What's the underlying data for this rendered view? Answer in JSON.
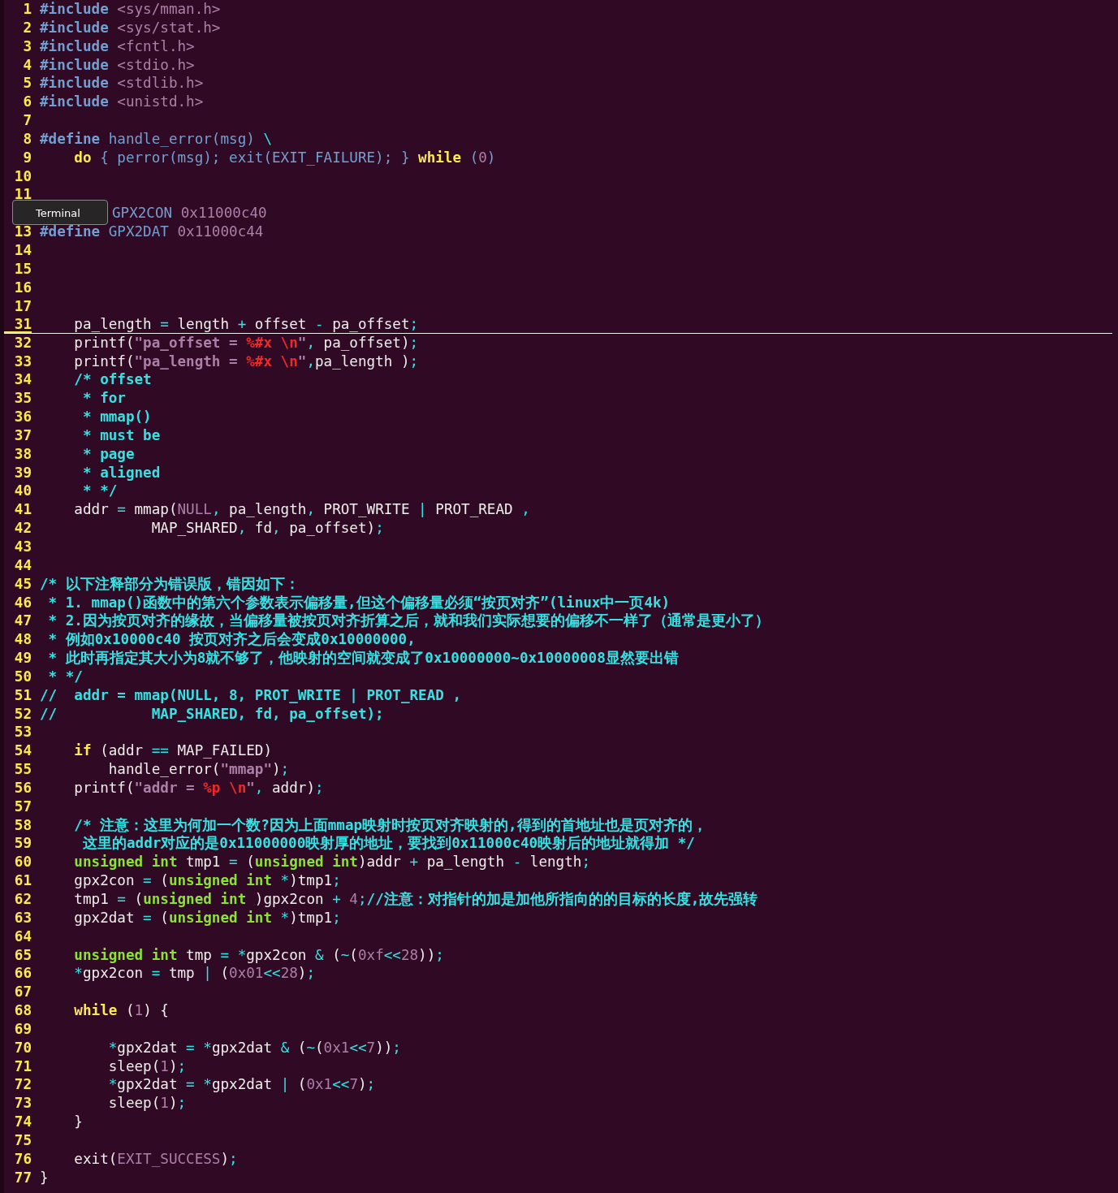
{
  "tooltip": {
    "label": "Terminal"
  },
  "lines": [
    {
      "n": "1",
      "cursor": false,
      "code": [
        {
          "t": "#include",
          "kind": "pp"
        },
        {
          "t": " <sys/mman.h>",
          "kind": "hdr"
        }
      ]
    },
    {
      "n": "2",
      "cursor": false,
      "code": [
        {
          "t": "#include",
          "kind": "pp"
        },
        {
          "t": " <sys/stat.h>",
          "kind": "hdr"
        }
      ]
    },
    {
      "n": "3",
      "cursor": false,
      "code": [
        {
          "t": "#include",
          "kind": "pp"
        },
        {
          "t": " <fcntl.h>",
          "kind": "hdr"
        }
      ]
    },
    {
      "n": "4",
      "cursor": false,
      "code": [
        {
          "t": "#include",
          "kind": "pp"
        },
        {
          "t": " <stdio.h>",
          "kind": "hdr"
        }
      ]
    },
    {
      "n": "5",
      "cursor": false,
      "code": [
        {
          "t": "#include",
          "kind": "pp"
        },
        {
          "t": " <stdlib.h>",
          "kind": "hdr"
        }
      ]
    },
    {
      "n": "6",
      "cursor": false,
      "code": [
        {
          "t": "#include",
          "kind": "pp"
        },
        {
          "t": " <unistd.h>",
          "kind": "hdr"
        }
      ]
    },
    {
      "n": "7",
      "cursor": false
    },
    {
      "n": "8",
      "cursor": false,
      "code": [
        {
          "t": "#define",
          "kind": "pp"
        },
        {
          "t": " handle_error(msg) ",
          "kind": "pp2"
        },
        {
          "t": "\\",
          "kind": "op"
        }
      ]
    },
    {
      "n": "9",
      "cursor": false,
      "code": [
        {
          "t": "    do",
          "kind": "kw"
        },
        {
          "t": " { perror(msg); exit(EXIT_FAILURE); } ",
          "kind": "pp2"
        },
        {
          "t": "while",
          "kind": "kw"
        },
        {
          "t": " (",
          "kind": "pp2"
        },
        {
          "t": "0",
          "kind": "num"
        },
        {
          "t": ")",
          "kind": "pp2"
        }
      ]
    },
    {
      "n": "10",
      "cursor": false
    },
    {
      "n": "11",
      "cursor": false
    },
    {
      "cursor": false,
      "kind": "covered",
      "code": [
        {
          "t": "GPX2CON ",
          "kind": "pp2"
        },
        {
          "t": "0x11000c40",
          "kind": "num"
        }
      ]
    },
    {
      "n": "13",
      "cursor": false,
      "code": [
        {
          "t": "#define",
          "kind": "pp"
        },
        {
          "t": " GPX2DAT ",
          "kind": "pp2"
        },
        {
          "t": "0x11000c44",
          "kind": "num"
        }
      ]
    },
    {
      "n": "14",
      "cursor": false
    },
    {
      "n": "15",
      "cursor": false
    },
    {
      "n": "16",
      "cursor": false
    },
    {
      "n": "17",
      "cursor": false
    },
    {
      "n": "31",
      "cursor": true,
      "code": [
        {
          "t": "    pa_length ",
          "kind": "plain"
        },
        {
          "t": "=",
          "kind": "op"
        },
        {
          "t": " length ",
          "kind": "plain"
        },
        {
          "t": "+",
          "kind": "op"
        },
        {
          "t": " offset ",
          "kind": "plain"
        },
        {
          "t": "-",
          "kind": "op"
        },
        {
          "t": " pa_offset",
          "kind": "plain"
        },
        {
          "t": ";",
          "kind": "op"
        }
      ]
    },
    {
      "n": "32",
      "cursor": false,
      "code": [
        {
          "t": "    printf(",
          "kind": "plain"
        },
        {
          "t": "\"pa_offset = ",
          "kind": "str"
        },
        {
          "t": "%#x \\n",
          "kind": "esc"
        },
        {
          "t": "\"",
          "kind": "str"
        },
        {
          "t": ",",
          "kind": "op"
        },
        {
          "t": " pa_offset)",
          "kind": "plain"
        },
        {
          "t": ";",
          "kind": "op"
        }
      ]
    },
    {
      "n": "33",
      "cursor": false,
      "code": [
        {
          "t": "    printf(",
          "kind": "plain"
        },
        {
          "t": "\"pa_length = ",
          "kind": "str"
        },
        {
          "t": "%#x \\n",
          "kind": "esc"
        },
        {
          "t": "\"",
          "kind": "str"
        },
        {
          "t": ",",
          "kind": "op"
        },
        {
          "t": "pa_length )",
          "kind": "plain"
        },
        {
          "t": ";",
          "kind": "op"
        }
      ]
    },
    {
      "n": "34",
      "cursor": false,
      "code": [
        {
          "t": "    /* offset",
          "kind": "cm"
        }
      ]
    },
    {
      "n": "35",
      "cursor": false,
      "code": [
        {
          "t": "     * for",
          "kind": "cm"
        }
      ]
    },
    {
      "n": "36",
      "cursor": false,
      "code": [
        {
          "t": "     * mmap()",
          "kind": "cm"
        }
      ]
    },
    {
      "n": "37",
      "cursor": false,
      "code": [
        {
          "t": "     * must be",
          "kind": "cm"
        }
      ]
    },
    {
      "n": "38",
      "cursor": false,
      "code": [
        {
          "t": "     * page",
          "kind": "cm"
        }
      ]
    },
    {
      "n": "39",
      "cursor": false,
      "code": [
        {
          "t": "     * aligned",
          "kind": "cm"
        }
      ]
    },
    {
      "n": "40",
      "cursor": false,
      "code": [
        {
          "t": "     * */",
          "kind": "cm"
        }
      ]
    },
    {
      "n": "41",
      "cursor": false,
      "code": [
        {
          "t": "    addr ",
          "kind": "plain"
        },
        {
          "t": "=",
          "kind": "op"
        },
        {
          "t": " mmap(",
          "kind": "plain"
        },
        {
          "t": "NULL",
          "kind": "num"
        },
        {
          "t": ",",
          "kind": "op"
        },
        {
          "t": " pa_length",
          "kind": "plain"
        },
        {
          "t": ",",
          "kind": "op"
        },
        {
          "t": " PROT_WRITE ",
          "kind": "plain"
        },
        {
          "t": "|",
          "kind": "op"
        },
        {
          "t": " PROT_READ ",
          "kind": "plain"
        },
        {
          "t": ",",
          "kind": "op"
        }
      ]
    },
    {
      "n": "42",
      "cursor": false,
      "code": [
        {
          "t": "             MAP_SHARED",
          "kind": "plain"
        },
        {
          "t": ",",
          "kind": "op"
        },
        {
          "t": " fd",
          "kind": "plain"
        },
        {
          "t": ",",
          "kind": "op"
        },
        {
          "t": " pa_offset)",
          "kind": "plain"
        },
        {
          "t": ";",
          "kind": "op"
        }
      ]
    },
    {
      "n": "43",
      "cursor": false
    },
    {
      "n": "44",
      "cursor": false
    },
    {
      "n": "45",
      "cursor": false,
      "code": [
        {
          "t": "/* 以下注释部分为错误版，错因如下：",
          "kind": "cm"
        }
      ]
    },
    {
      "n": "46",
      "cursor": false,
      "code": [
        {
          "t": " * 1. mmap()函数中的第六个参数表示偏移量,但这个偏移量必须“按页对齐”(linux中一页4k)",
          "kind": "cm"
        }
      ]
    },
    {
      "n": "47",
      "cursor": false,
      "code": [
        {
          "t": " * 2.因为按页对齐的缘故，当偏移量被按页对齐折算之后，就和我们实际想要的偏移不一样了（通常是更小了）",
          "kind": "cm"
        }
      ]
    },
    {
      "n": "48",
      "cursor": false,
      "code": [
        {
          "t": " * 例如0x10000c40 按页对齐之后会变成0x10000000,",
          "kind": "cm"
        }
      ]
    },
    {
      "n": "49",
      "cursor": false,
      "code": [
        {
          "t": " * 此时再指定其大小为8就不够了，他映射的空间就变成了0x10000000~0x10000008显然要出错",
          "kind": "cm"
        }
      ]
    },
    {
      "n": "50",
      "cursor": false,
      "code": [
        {
          "t": " * */",
          "kind": "cm"
        }
      ]
    },
    {
      "n": "51",
      "cursor": false,
      "code": [
        {
          "t": "//  addr = mmap(NULL, 8, PROT_WRITE | PROT_READ ,",
          "kind": "cm"
        }
      ]
    },
    {
      "n": "52",
      "cursor": false,
      "code": [
        {
          "t": "//           MAP_SHARED, fd, pa_offset);",
          "kind": "cm"
        }
      ]
    },
    {
      "n": "53",
      "cursor": false
    },
    {
      "n": "54",
      "cursor": false,
      "code": [
        {
          "t": "    if",
          "kind": "kw"
        },
        {
          "t": " (addr ",
          "kind": "plain"
        },
        {
          "t": "==",
          "kind": "op"
        },
        {
          "t": " MAP_FAILED)",
          "kind": "plain"
        }
      ]
    },
    {
      "n": "55",
      "cursor": false,
      "code": [
        {
          "t": "        handle_error(",
          "kind": "plain"
        },
        {
          "t": "\"mmap\"",
          "kind": "str"
        },
        {
          "t": ")",
          "kind": "plain"
        },
        {
          "t": ";",
          "kind": "op"
        }
      ]
    },
    {
      "n": "56",
      "cursor": false,
      "code": [
        {
          "t": "    printf(",
          "kind": "plain"
        },
        {
          "t": "\"addr = ",
          "kind": "str"
        },
        {
          "t": "%p \\n",
          "kind": "esc"
        },
        {
          "t": "\"",
          "kind": "str"
        },
        {
          "t": ",",
          "kind": "op"
        },
        {
          "t": " addr)",
          "kind": "plain"
        },
        {
          "t": ";",
          "kind": "op"
        }
      ]
    },
    {
      "n": "57",
      "cursor": false
    },
    {
      "n": "58",
      "cursor": false,
      "code": [
        {
          "t": "    /* 注意：这里为何加一个数?因为上面mmap映射时按页对齐映射的,得到的首地址也是页对齐的，",
          "kind": "cm"
        }
      ]
    },
    {
      "n": "59",
      "cursor": false,
      "code": [
        {
          "t": "     这里的addr对应的是0x11000000映射厚的地址，要找到0x11000c40映射后的地址就得加 */",
          "kind": "cm"
        }
      ]
    },
    {
      "n": "60",
      "cursor": false,
      "code": [
        {
          "t": "    unsigned int",
          "kind": "type"
        },
        {
          "t": " tmp1 ",
          "kind": "plain"
        },
        {
          "t": "=",
          "kind": "op"
        },
        {
          "t": " (",
          "kind": "plain"
        },
        {
          "t": "unsigned int",
          "kind": "type"
        },
        {
          "t": ")addr ",
          "kind": "plain"
        },
        {
          "t": "+",
          "kind": "op"
        },
        {
          "t": " pa_length ",
          "kind": "plain"
        },
        {
          "t": "-",
          "kind": "op"
        },
        {
          "t": " length",
          "kind": "plain"
        },
        {
          "t": ";",
          "kind": "op"
        }
      ]
    },
    {
      "n": "61",
      "cursor": false,
      "code": [
        {
          "t": "    gpx2con ",
          "kind": "plain"
        },
        {
          "t": "=",
          "kind": "op"
        },
        {
          "t": " (",
          "kind": "plain"
        },
        {
          "t": "unsigned int",
          "kind": "type"
        },
        {
          "t": " *",
          "kind": "op"
        },
        {
          "t": ")tmp1",
          "kind": "plain"
        },
        {
          "t": ";",
          "kind": "op"
        }
      ]
    },
    {
      "n": "62",
      "cursor": false,
      "code": [
        {
          "t": "    tmp1 ",
          "kind": "plain"
        },
        {
          "t": "=",
          "kind": "op"
        },
        {
          "t": " (",
          "kind": "plain"
        },
        {
          "t": "unsigned int",
          "kind": "type"
        },
        {
          "t": " )gpx2con ",
          "kind": "plain"
        },
        {
          "t": "+",
          "kind": "op"
        },
        {
          "t": " 4",
          "kind": "num"
        },
        {
          "t": ";",
          "kind": "op"
        },
        {
          "t": "//注意：对指针的加是加他所指向的的目标的长度,故先强转",
          "kind": "cm"
        }
      ]
    },
    {
      "n": "63",
      "cursor": false,
      "code": [
        {
          "t": "    gpx2dat ",
          "kind": "plain"
        },
        {
          "t": "=",
          "kind": "op"
        },
        {
          "t": " (",
          "kind": "plain"
        },
        {
          "t": "unsigned int",
          "kind": "type"
        },
        {
          "t": " *",
          "kind": "op"
        },
        {
          "t": ")tmp1",
          "kind": "plain"
        },
        {
          "t": ";",
          "kind": "op"
        }
      ]
    },
    {
      "n": "64",
      "cursor": false
    },
    {
      "n": "65",
      "cursor": false,
      "code": [
        {
          "t": "    unsigned int",
          "kind": "type"
        },
        {
          "t": " tmp ",
          "kind": "plain"
        },
        {
          "t": "=",
          "kind": "op"
        },
        {
          "t": " *",
          "kind": "op"
        },
        {
          "t": "gpx2con ",
          "kind": "plain"
        },
        {
          "t": "&",
          "kind": "op"
        },
        {
          "t": " (",
          "kind": "plain"
        },
        {
          "t": "~",
          "kind": "op"
        },
        {
          "t": "(",
          "kind": "plain"
        },
        {
          "t": "0xf",
          "kind": "num"
        },
        {
          "t": "<<",
          "kind": "op"
        },
        {
          "t": "28",
          "kind": "num"
        },
        {
          "t": "))",
          "kind": "plain"
        },
        {
          "t": ";",
          "kind": "op"
        }
      ]
    },
    {
      "n": "66",
      "cursor": false,
      "code": [
        {
          "t": "    *",
          "kind": "op"
        },
        {
          "t": "gpx2con ",
          "kind": "plain"
        },
        {
          "t": "=",
          "kind": "op"
        },
        {
          "t": " tmp ",
          "kind": "plain"
        },
        {
          "t": "|",
          "kind": "op"
        },
        {
          "t": " (",
          "kind": "plain"
        },
        {
          "t": "0x01",
          "kind": "num"
        },
        {
          "t": "<<",
          "kind": "op"
        },
        {
          "t": "28",
          "kind": "num"
        },
        {
          "t": ")",
          "kind": "plain"
        },
        {
          "t": ";",
          "kind": "op"
        }
      ]
    },
    {
      "n": "67",
      "cursor": false
    },
    {
      "n": "68",
      "cursor": false,
      "code": [
        {
          "t": "    while",
          "kind": "kw"
        },
        {
          "t": " (",
          "kind": "plain"
        },
        {
          "t": "1",
          "kind": "num"
        },
        {
          "t": ") {",
          "kind": "plain"
        }
      ]
    },
    {
      "n": "69",
      "cursor": false
    },
    {
      "n": "70",
      "cursor": false,
      "code": [
        {
          "t": "        *",
          "kind": "op"
        },
        {
          "t": "gpx2dat ",
          "kind": "plain"
        },
        {
          "t": "=",
          "kind": "op"
        },
        {
          "t": " *",
          "kind": "op"
        },
        {
          "t": "gpx2dat ",
          "kind": "plain"
        },
        {
          "t": "&",
          "kind": "op"
        },
        {
          "t": " (",
          "kind": "plain"
        },
        {
          "t": "~",
          "kind": "op"
        },
        {
          "t": "(",
          "kind": "plain"
        },
        {
          "t": "0x1",
          "kind": "num"
        },
        {
          "t": "<<",
          "kind": "op"
        },
        {
          "t": "7",
          "kind": "num"
        },
        {
          "t": "))",
          "kind": "plain"
        },
        {
          "t": ";",
          "kind": "op"
        }
      ]
    },
    {
      "n": "71",
      "cursor": false,
      "code": [
        {
          "t": "        sleep(",
          "kind": "plain"
        },
        {
          "t": "1",
          "kind": "num"
        },
        {
          "t": ")",
          "kind": "plain"
        },
        {
          "t": ";",
          "kind": "op"
        }
      ]
    },
    {
      "n": "72",
      "cursor": false,
      "code": [
        {
          "t": "        *",
          "kind": "op"
        },
        {
          "t": "gpx2dat ",
          "kind": "plain"
        },
        {
          "t": "=",
          "kind": "op"
        },
        {
          "t": " *",
          "kind": "op"
        },
        {
          "t": "gpx2dat ",
          "kind": "plain"
        },
        {
          "t": "|",
          "kind": "op"
        },
        {
          "t": " (",
          "kind": "plain"
        },
        {
          "t": "0x1",
          "kind": "num"
        },
        {
          "t": "<<",
          "kind": "op"
        },
        {
          "t": "7",
          "kind": "num"
        },
        {
          "t": ")",
          "kind": "plain"
        },
        {
          "t": ";",
          "kind": "op"
        }
      ]
    },
    {
      "n": "73",
      "cursor": false,
      "code": [
        {
          "t": "        sleep(",
          "kind": "plain"
        },
        {
          "t": "1",
          "kind": "num"
        },
        {
          "t": ")",
          "kind": "plain"
        },
        {
          "t": ";",
          "kind": "op"
        }
      ]
    },
    {
      "n": "74",
      "cursor": false,
      "code": [
        {
          "t": "    }",
          "kind": "plain"
        }
      ]
    },
    {
      "n": "75",
      "cursor": false
    },
    {
      "n": "76",
      "cursor": false,
      "code": [
        {
          "t": "    exit(",
          "kind": "plain"
        },
        {
          "t": "EXIT_SUCCESS",
          "kind": "num"
        },
        {
          "t": ")",
          "kind": "plain"
        },
        {
          "t": ";",
          "kind": "op"
        }
      ]
    },
    {
      "n": "77",
      "cursor": false,
      "code": [
        {
          "t": "}",
          "kind": "plain"
        }
      ]
    }
  ]
}
